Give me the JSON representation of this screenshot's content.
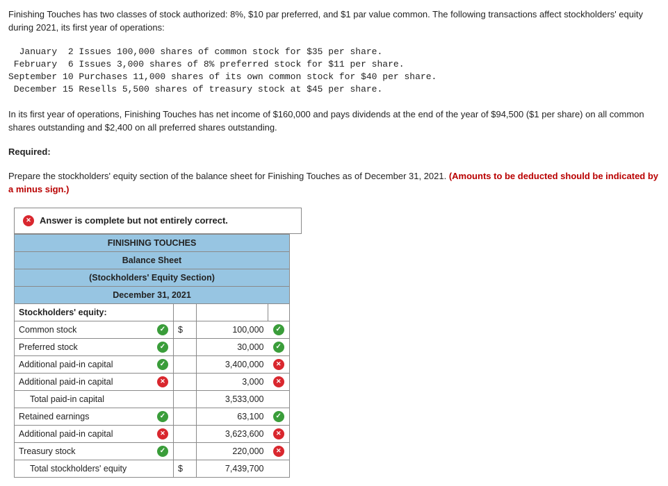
{
  "intro_p1": "Finishing Touches has two classes of stock authorized: 8%, $10 par preferred, and $1 par value common. The following transactions affect stockholders' equity during 2021, its first year of operations:",
  "transactions_text": "  January  2 Issues 100,000 shares of common stock for $35 per share.\n February  6 Issues 3,000 shares of 8% preferred stock for $11 per share.\nSeptember 10 Purchases 11,000 shares of its own common stock for $40 per share.\n December 15 Resells 5,500 shares of treasury stock at $45 per share.",
  "intro_p2": "In its first year of operations, Finishing Touches has net income of $160,000 and pays dividends at the end of the year of $94,500 ($1 per share) on all common shares outstanding and $2,400 on all preferred shares outstanding.",
  "required_label": "Required:",
  "required_text_a": "Prepare the stockholders' equity section of the balance sheet for Finishing Touches as of December 31, 2021. ",
  "required_text_b": "(Amounts to be deducted should be indicated by a minus sign.)",
  "answer_banner": "Answer is complete but not entirely correct.",
  "sheet": {
    "h1": "FINISHING TOUCHES",
    "h2": "Balance Sheet",
    "h3": "(Stockholders' Equity Section)",
    "h4": "December 31, 2021",
    "section_label": "Stockholders' equity:",
    "rows": [
      {
        "label": "Common stock",
        "indent": false,
        "label_icon": "check",
        "prefix": "$",
        "amount": "100,000",
        "amt_icon": "check"
      },
      {
        "label": "Preferred stock",
        "indent": false,
        "label_icon": "check",
        "prefix": "",
        "amount": "30,000",
        "amt_icon": "check"
      },
      {
        "label": "Additional paid-in capital",
        "indent": false,
        "label_icon": "check",
        "prefix": "",
        "amount": "3,400,000",
        "amt_icon": "x"
      },
      {
        "label": "Additional paid-in capital",
        "indent": false,
        "label_icon": "x",
        "prefix": "",
        "amount": "3,000",
        "amt_icon": "x"
      },
      {
        "label": "Total paid-in capital",
        "indent": true,
        "label_icon": "",
        "prefix": "",
        "amount": "3,533,000",
        "amt_icon": ""
      },
      {
        "label": "Retained earnings",
        "indent": false,
        "label_icon": "check",
        "prefix": "",
        "amount": "63,100",
        "amt_icon": "check"
      },
      {
        "label": "Additional paid-in capital",
        "indent": false,
        "label_icon": "x",
        "prefix": "",
        "amount": "3,623,600",
        "amt_icon": "x"
      },
      {
        "label": "Treasury stock",
        "indent": false,
        "label_icon": "check",
        "prefix": "",
        "amount": "220,000",
        "amt_icon": "x"
      },
      {
        "label": "Total stockholders' equity",
        "indent": true,
        "label_icon": "",
        "prefix": "$",
        "amount": "7,439,700",
        "amt_icon": ""
      }
    ]
  }
}
